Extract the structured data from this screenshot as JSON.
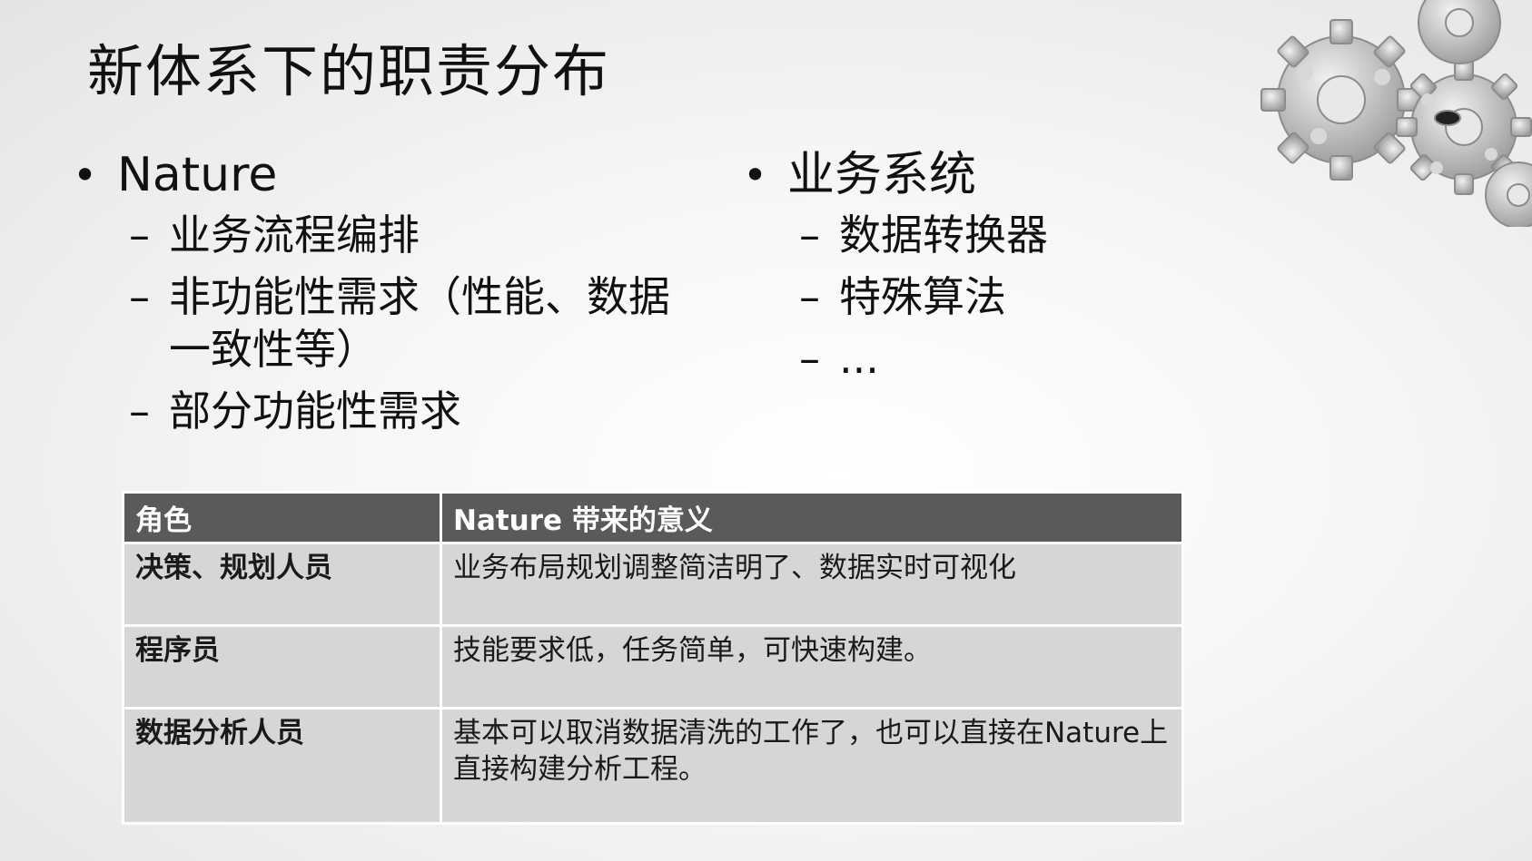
{
  "slide": {
    "title": "新体系下的职责分布",
    "left_column": {
      "bullet": "Nature",
      "items": [
        "业务流程编排",
        "非功能性需求（性能、数据一致性等）",
        "部分功能性需求"
      ]
    },
    "right_column": {
      "bullet": "业务系统",
      "items": [
        "数据转换器",
        "特殊算法",
        "..."
      ]
    },
    "table": {
      "headers": [
        "角色",
        "Nature 带来的意义"
      ],
      "rows": [
        {
          "role": "决策、规划人员",
          "meaning": "业务布局规划调整简洁明了、数据实时可视化"
        },
        {
          "role": "程序员",
          "meaning": "技能要求低，任务简单，可快速构建。"
        },
        {
          "role": "数据分析人员",
          "meaning": "基本可以取消数据清洗的工作了，也可以直接在Nature上直接构建分析工程。"
        }
      ]
    },
    "colors": {
      "table_header_bg": "#5a5a5a",
      "table_cell_bg": "#d6d6d6",
      "gear": "#b8b8b8"
    },
    "decoration": {
      "icon": "gears-icon"
    },
    "bullet_glyph": "•",
    "dash_glyph": "–"
  }
}
